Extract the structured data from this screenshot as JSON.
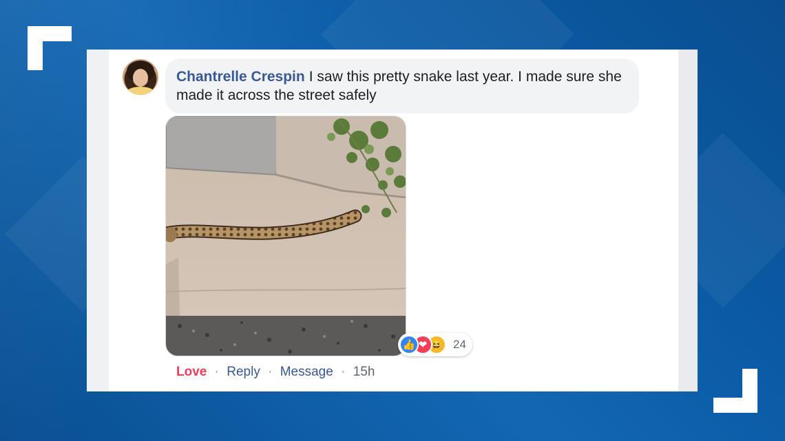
{
  "comment": {
    "author": "Chantrelle Crespin",
    "text": "I saw this pretty snake last year. I made sure she made it across the street safely"
  },
  "reactions": {
    "count": "24",
    "icons": [
      "like-icon",
      "love-icon",
      "haha-icon"
    ]
  },
  "actions": {
    "love_label": "Love",
    "separator": "·",
    "reply_label": "Reply",
    "message_label": "Message",
    "timestamp": "15h"
  },
  "colors": {
    "author": "#385898",
    "love": "#f33e58",
    "bubble": "#f2f3f5",
    "background": "#0d5aa0"
  }
}
